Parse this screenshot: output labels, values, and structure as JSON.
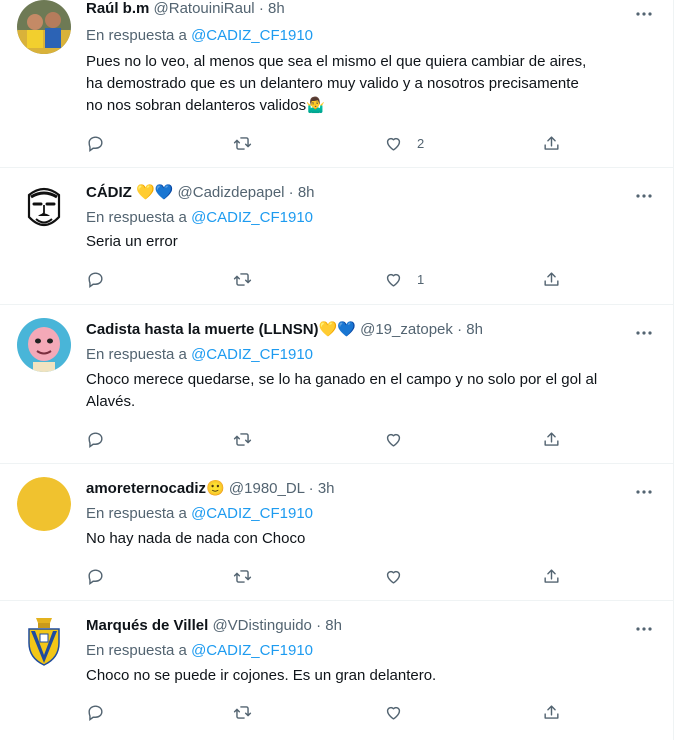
{
  "tweets": [
    {
      "name": "Raúl b.m",
      "handle": "@RatouiniRaul",
      "time": "8h",
      "reply_prefix": "En respuesta a",
      "reply_to": "@CADIZ_CF1910",
      "lines": [
        "Pues no lo veo, al menos que sea el mismo el que quiera cambiar de aires,",
        "ha demostrado que es un delantero muy valido y a nosotros precisamente",
        "no nos sobran delanteros validos🤷‍♂️"
      ],
      "like_count": "2"
    },
    {
      "name": "CÁDIZ",
      "name_emoji": "💛💙",
      "handle": "@Cadizdepapel",
      "time": "8h",
      "reply_prefix": "En respuesta a",
      "reply_to": "@CADIZ_CF1910",
      "lines": [
        "Seria un error"
      ],
      "like_count": "1"
    },
    {
      "name": "Cadista hasta la muerte (LLNSN)",
      "name_emoji": "💛💙",
      "handle": "@19_zatopek",
      "time": "8h",
      "reply_prefix": "En respuesta a",
      "reply_to": "@CADIZ_CF1910",
      "lines": [
        "Choco merece quedarse, se lo ha ganado en el campo y no solo por el gol al",
        "Alavés."
      ],
      "like_count": ""
    },
    {
      "name": "amoreternocadiz",
      "name_emoji": "🙂",
      "handle": "@1980_DL",
      "time": "3h",
      "reply_prefix": "En respuesta a",
      "reply_to": "@CADIZ_CF1910",
      "lines": [
        "No hay nada de nada con Choco"
      ],
      "like_count": ""
    },
    {
      "name": "Marqués de Villel",
      "handle": "@VDistinguido",
      "time": "8h",
      "reply_prefix": "En respuesta a",
      "reply_to": "@CADIZ_CF1910",
      "lines": [
        "Choco no se puede ir cojones. Es un gran delantero."
      ],
      "like_count": ""
    }
  ],
  "separator": "·",
  "icons": {
    "reply": "reply-icon",
    "retweet": "retweet-icon",
    "like": "like-icon",
    "share": "share-icon",
    "more": "more-icon"
  },
  "colors": {
    "accent": "#1d9bf0",
    "secondary_text": "#536471",
    "primary_text": "#0f1419"
  }
}
